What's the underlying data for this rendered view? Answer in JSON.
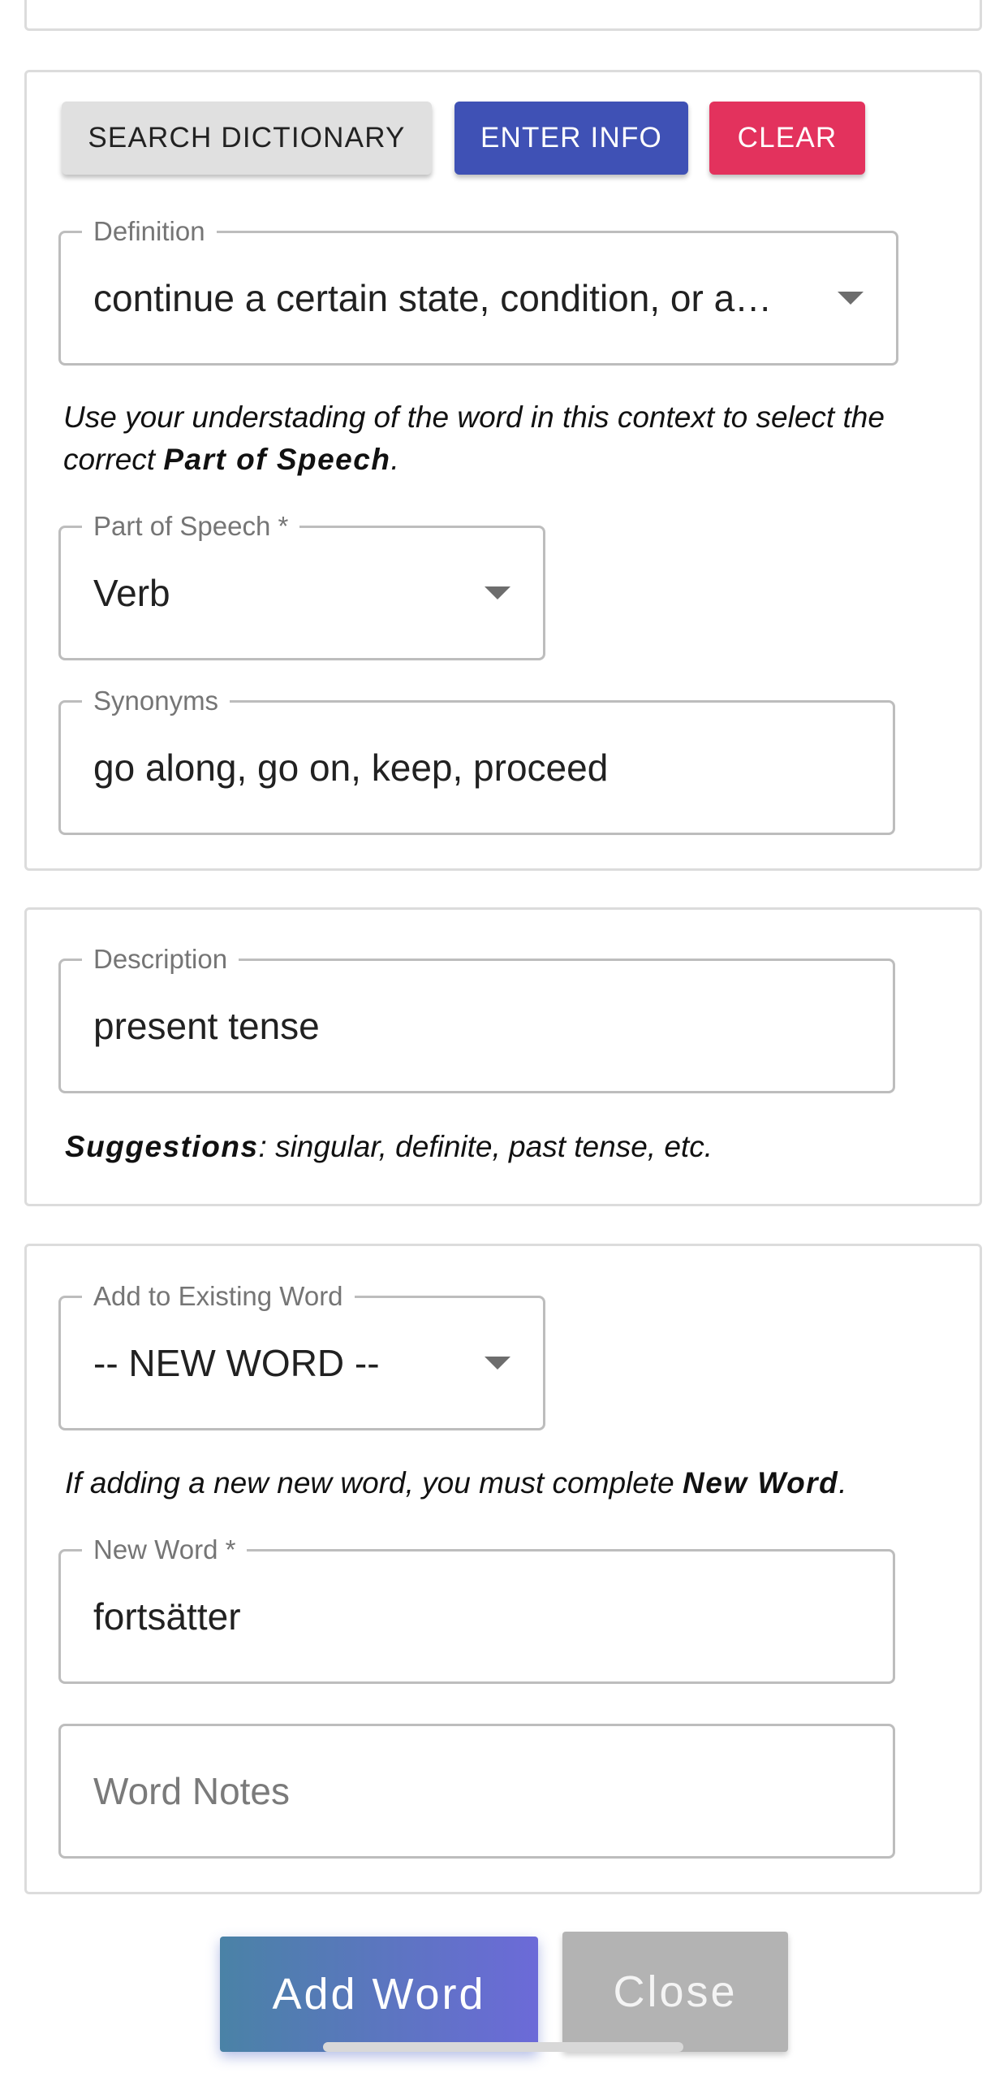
{
  "buttons": {
    "search_dictionary": "SEARCH DICTIONARY",
    "enter_info": "ENTER INFO",
    "clear": "CLEAR"
  },
  "definition": {
    "label": "Definition",
    "value": "continue a certain state, condition, or a…"
  },
  "pos_hint": {
    "text": "Use your understading of the word in this context to select the correct ",
    "emphasis": "Part of Speech",
    "end": "."
  },
  "part_of_speech": {
    "label": "Part of Speech *",
    "value": "Verb"
  },
  "synonyms": {
    "label": "Synonyms",
    "value": "go along, go on, keep, proceed"
  },
  "description": {
    "label": "Description",
    "value": "present tense"
  },
  "suggestions": {
    "label": "Suggestions",
    "text": ": singular, definite, past tense, etc."
  },
  "existing_word": {
    "label": "Add to Existing Word",
    "value": "-- NEW WORD --"
  },
  "new_word_hint": {
    "text": "If adding a new new word, you must complete ",
    "emphasis": "New Word",
    "end": "."
  },
  "new_word": {
    "label": "New Word *",
    "value": "fortsätter"
  },
  "word_notes": {
    "placeholder": "Word Notes"
  },
  "footer": {
    "add_word": "Add Word",
    "close": "Close"
  },
  "colors": {
    "indigo": "#3f51b5",
    "pink": "#e3325d",
    "add_word_gradient_start": "#4a82a6",
    "add_word_gradient_end": "#6c6ad8",
    "close_bg": "#b3b3b3"
  }
}
